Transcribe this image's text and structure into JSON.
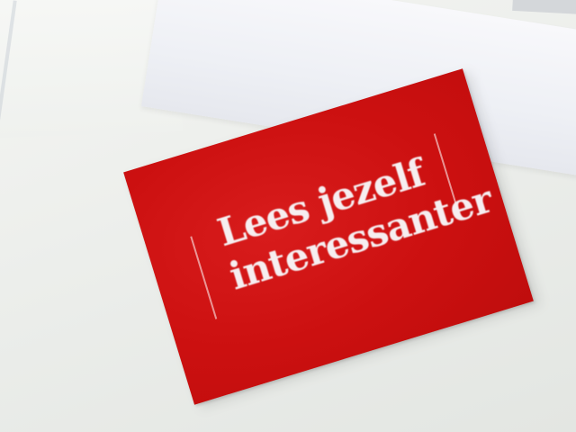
{
  "card": {
    "line1": "Lees jezelf",
    "line2": "interessanter",
    "color": "#cc1010",
    "text_color": "#f6eef0"
  },
  "background": {
    "table_color": "#eceeeb",
    "paper_color": "#f0f2f5"
  }
}
